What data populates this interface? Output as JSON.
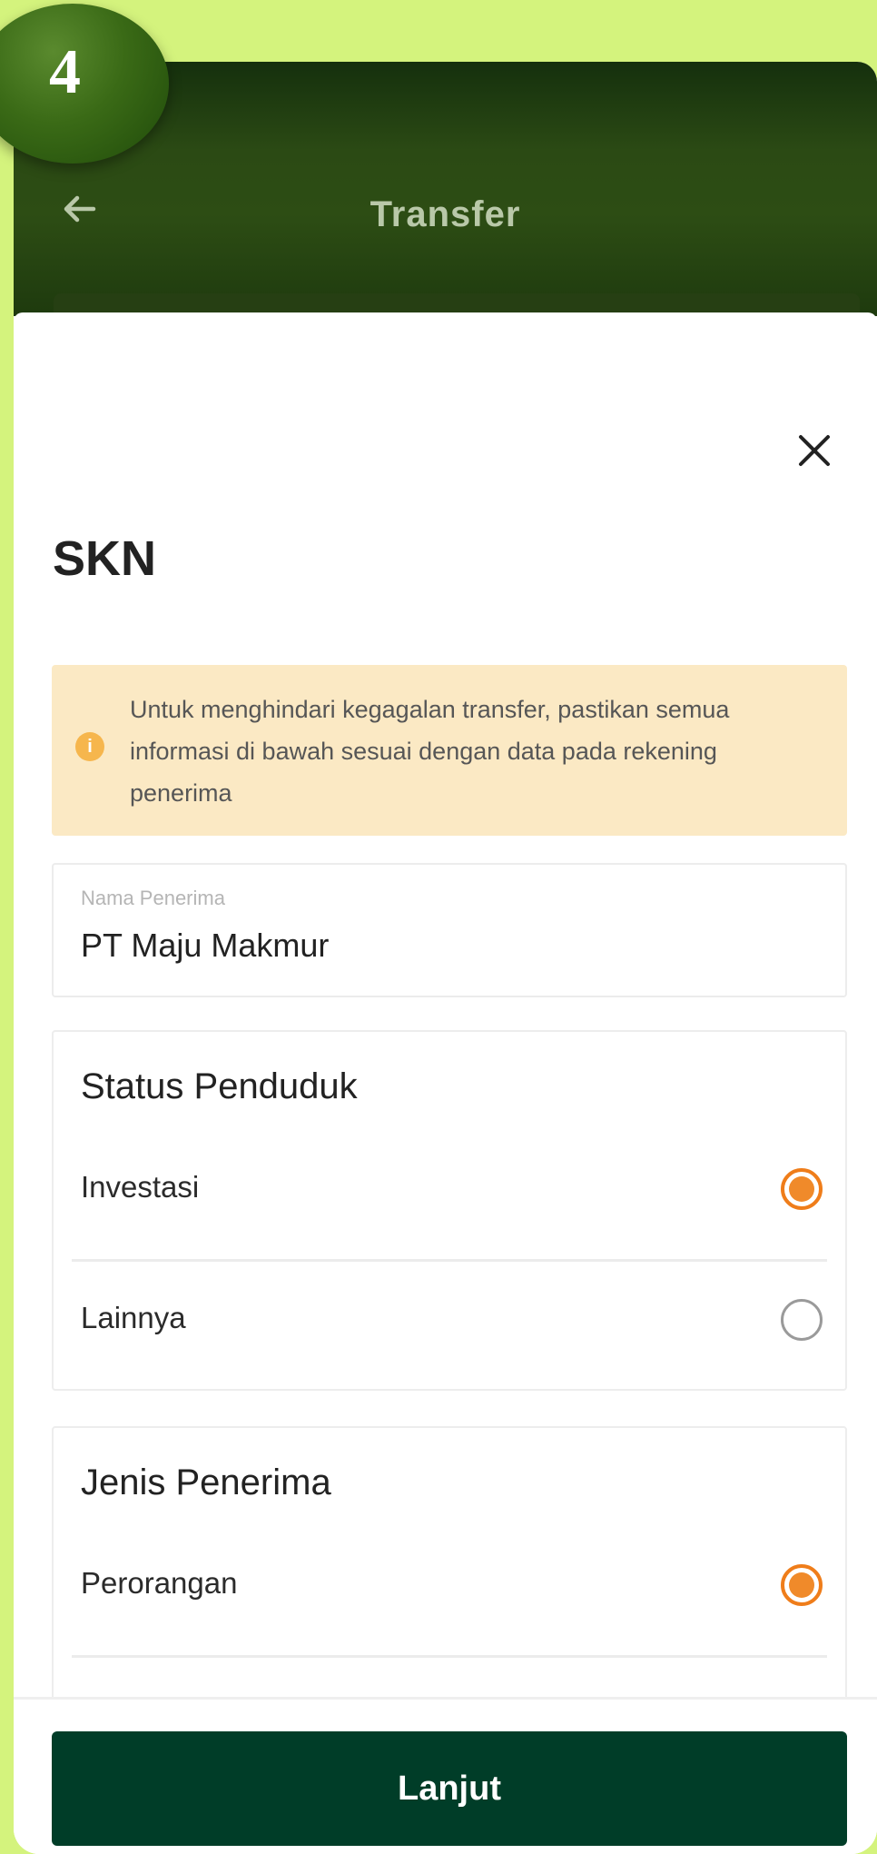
{
  "step_badge": {
    "number": "4"
  },
  "header": {
    "title": "Transfer",
    "back_icon": "arrow-left-icon"
  },
  "sheet": {
    "close_icon": "close-icon",
    "title": "SKN",
    "notice": {
      "icon": "info-icon",
      "icon_glyph": "i",
      "text": "Untuk menghindari kegagalan transfer, pastikan semua informasi di bawah sesuai dengan data pada rekening penerima"
    },
    "recipient_field": {
      "label": "Nama Penerima",
      "value": "PT Maju Makmur"
    },
    "status_penduduk": {
      "title": "Status Penduduk",
      "options": [
        {
          "label": "Investasi",
          "selected": true
        },
        {
          "label": "Lainnya",
          "selected": false
        }
      ]
    },
    "jenis_penerima": {
      "title": "Jenis Penerima",
      "options": [
        {
          "label": "Perorangan",
          "selected": true
        }
      ]
    }
  },
  "footer": {
    "cta_label": "Lanjut"
  },
  "colors": {
    "background": "#d4f37d",
    "header_dark_green": "#2b4a14",
    "notice_bg": "#fbe9c4",
    "radio_accent": "#ef7d1a",
    "cta_bg": "#003d28"
  }
}
